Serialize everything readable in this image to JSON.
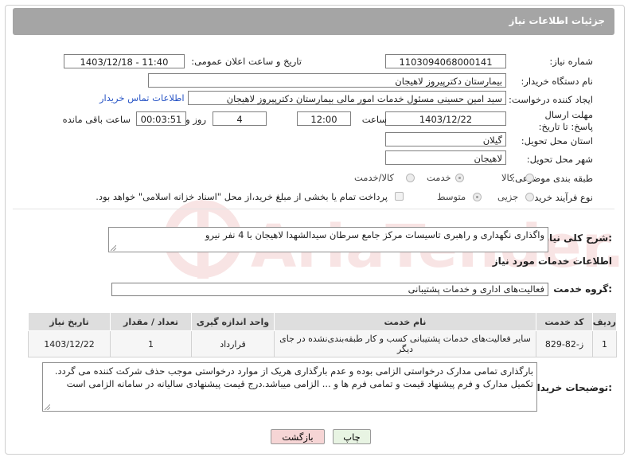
{
  "header": {
    "title": "جزئیات اطلاعات نیاز"
  },
  "form": {
    "need_number_label": "شماره نیاز:",
    "need_number": "1103094068000141",
    "announce_label": "تاریخ و ساعت اعلان عمومی:",
    "announce_value": "1403/12/18 - 11:40",
    "buyer_org_label": "نام دستگاه خریدار:",
    "buyer_org": "بیمارستان دکترپیروز لاهیجان",
    "creator_label": "ایجاد کننده درخواست:",
    "creator": "سید امین حسینی مسئول خدمات امور مالی بیمارستان دکترپیروز لاهیجان",
    "contact_link": "اطلاعات تماس خریدار",
    "deadline_label": "مهلت ارسال پاسخ: تا تاریخ:",
    "deadline_date": "1403/12/22",
    "time_label": "ساعت",
    "deadline_time": "12:00",
    "days_value": "4",
    "days_label": "روز و",
    "remaining_time": "00:03:51",
    "remaining_label": "ساعت باقی مانده",
    "province_label": "استان محل تحویل:",
    "province": "گیلان",
    "city_label": "شهر محل تحویل:",
    "city": "لاهیجان",
    "category_label": "طبقه بندی موضوعی:",
    "category_options": [
      "کالا",
      "خدمت",
      "کالا/خدمت"
    ],
    "category_selected": "خدمت",
    "process_label": "نوع فرآیند خرید :",
    "process_options": [
      "جزیی",
      "متوسط"
    ],
    "process_selected": "متوسط",
    "treasury_note": "پرداخت تمام یا بخشی از مبلغ خرید،از محل \"اسناد خزانه اسلامی\" خواهد بود."
  },
  "summary": {
    "label": "شرح کلی نیاز:",
    "text": "واگذاری نگهداری و راهبری تاسیسات مرکز جامع سرطان سیدالشهدا لاهیجان با 4 نفر نیرو"
  },
  "services": {
    "section_title": "اطلاعات خدمات مورد نیاز",
    "group_label": "گروه خدمت:",
    "group_value": "فعالیت‌های اداری و خدمات پشتیبانی",
    "columns": [
      "ردیف",
      "کد خدمت",
      "نام خدمت",
      "واحد اندازه گیری",
      "تعداد / مقدار",
      "تاریخ نیاز"
    ],
    "rows": [
      [
        "1",
        "ز-82-829",
        "سایر فعالیت‌های خدمات پشتیبانی کسب و کار طبقه‌بندی‌نشده در جای دیگر",
        "قرارداد",
        "1",
        "1403/12/22"
      ]
    ]
  },
  "buyer_notes": {
    "label": "توضیحات خریدار:",
    "text": "بارگذاری تمامی مدارک درخواستی الزامی بوده و عدم بارگذاری هریک از موارد درخواستی موجب حذف شرکت کننده می گردد. تکمیل مدارک و فرم پیشنهاد قیمت و تمامی فرم ها و ... الزامی میباشد.درج قیمت پیشنهادی سالیانه در سامانه الزامی است"
  },
  "buttons": {
    "print": "چاپ",
    "back": "بازگشت"
  },
  "watermark": {
    "text": "AriaTender.net"
  },
  "colors": {
    "header_bg": "#a5a5a5",
    "link": "#2a56c6",
    "back_btn": "#f6d5d5",
    "print_btn": "#e8f4e3"
  }
}
